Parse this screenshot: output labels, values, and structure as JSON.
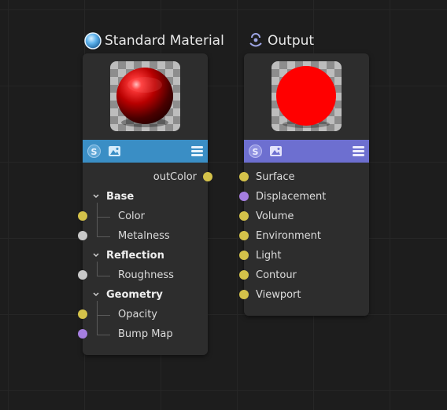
{
  "colors": {
    "port_yellow": "#d4c24a",
    "port_purple": "#a57ee0",
    "port_gray": "#c8c8c8",
    "standard_toolbar": "#3a8ec5",
    "output_toolbar": "#6d6fd0"
  },
  "standard_material": {
    "title": "Standard Material",
    "title_icon": "sphere-icon",
    "output": "outColor",
    "groups": [
      {
        "name": "Base",
        "inputs": [
          {
            "label": "Color",
            "port_color": "yellow"
          },
          {
            "label": "Metalness",
            "port_color": "gray"
          }
        ]
      },
      {
        "name": "Reflection",
        "inputs": [
          {
            "label": "Roughness",
            "port_color": "gray"
          }
        ]
      },
      {
        "name": "Geometry",
        "inputs": [
          {
            "label": "Opacity",
            "port_color": "yellow"
          },
          {
            "label": "Bump Map",
            "port_color": "purple"
          }
        ]
      }
    ]
  },
  "output_node": {
    "title": "Output",
    "title_icon": "output-icon",
    "inputs": [
      {
        "label": "Surface",
        "port_color": "yellow"
      },
      {
        "label": "Displacement",
        "port_color": "purple"
      },
      {
        "label": "Volume",
        "port_color": "yellow"
      },
      {
        "label": "Environment",
        "port_color": "yellow"
      },
      {
        "label": "Light",
        "port_color": "yellow"
      },
      {
        "label": "Contour",
        "port_color": "yellow"
      },
      {
        "label": "Viewport",
        "port_color": "yellow"
      }
    ]
  }
}
